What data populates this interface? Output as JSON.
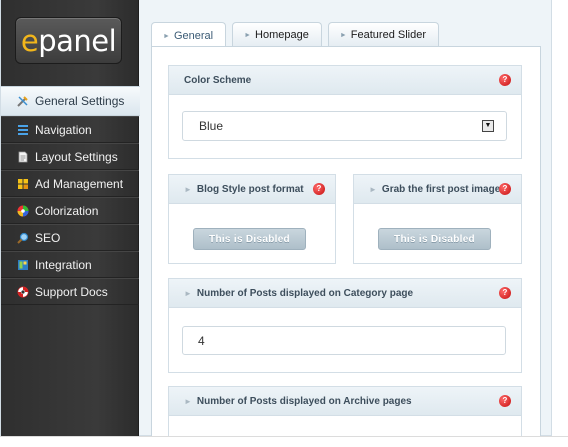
{
  "logo": {
    "prefix": "e",
    "rest": "panel"
  },
  "sidebar": {
    "items": [
      {
        "label": "General Settings",
        "icon": "tools-icon",
        "active": true
      },
      {
        "label": "Navigation",
        "icon": "navigation-icon"
      },
      {
        "label": "Layout Settings",
        "icon": "layout-icon"
      },
      {
        "label": "Ad Management",
        "icon": "ad-icon"
      },
      {
        "label": "Colorization",
        "icon": "color-wheel-icon"
      },
      {
        "label": "SEO",
        "icon": "magnifier-icon"
      },
      {
        "label": "Integration",
        "icon": "integration-icon"
      },
      {
        "label": "Support Docs",
        "icon": "lifebuoy-icon"
      }
    ]
  },
  "tabs": [
    {
      "label": "General",
      "active": true
    },
    {
      "label": "Homepage"
    },
    {
      "label": "Featured Slider"
    }
  ],
  "settings": {
    "color_scheme": {
      "title": "Color Scheme",
      "value": "Blue"
    },
    "blog_style": {
      "title": "Blog Style post format",
      "button": "This is Disabled"
    },
    "grab_image": {
      "title": "Grab the first post image",
      "button": "This is Disabled"
    },
    "posts_category": {
      "title": "Number of Posts displayed on Category page",
      "value": "4"
    },
    "posts_archive": {
      "title": "Number of Posts displayed on Archive pages"
    }
  },
  "help_glyph": "?",
  "colors": {
    "accent": "#f2b61b",
    "help": "#c40d0d",
    "sidebar": "#333333",
    "disabled_button": "#b9c8d1"
  }
}
